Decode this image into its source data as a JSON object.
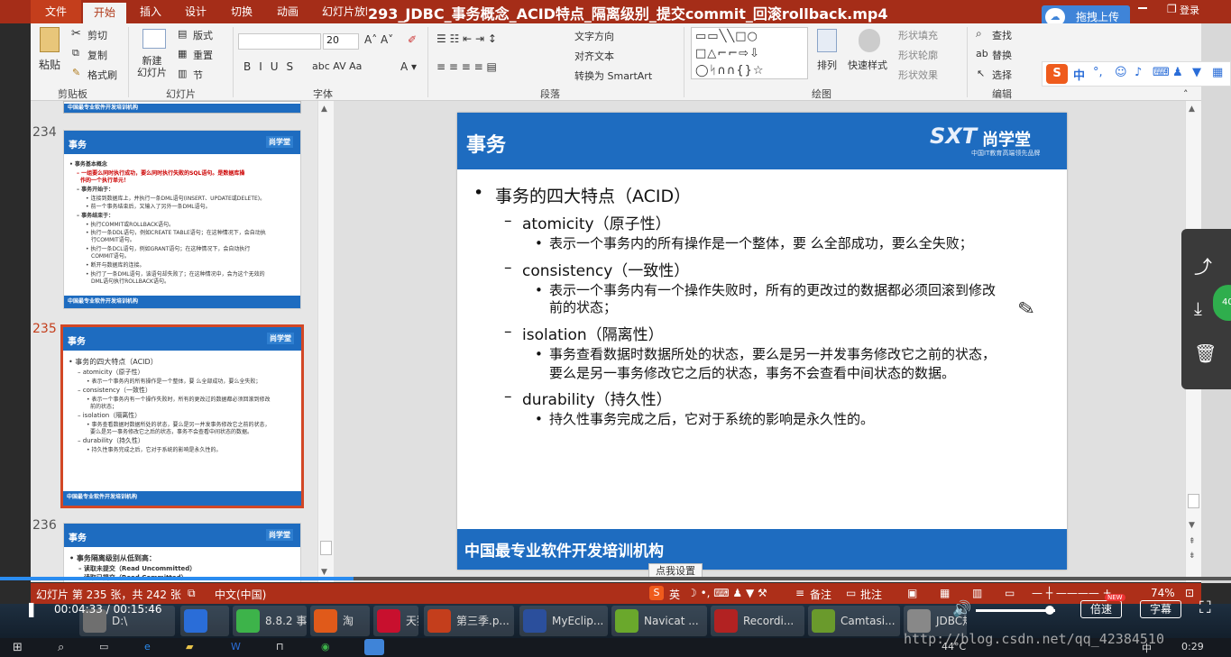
{
  "titlebar": {
    "tabs": [
      "文件",
      "开始",
      "插入",
      "设计",
      "切换",
      "动画",
      "幻灯片放映"
    ],
    "video_title": "293_JDBC_事务概念_ACID特点_隔离级别_提交commit_回滚rollback.mp4",
    "upload_label": "拖拽上传",
    "login_label": "登录"
  },
  "ribbon": {
    "clipboard": {
      "paste": "粘贴",
      "cut": "剪切",
      "copy": "复制",
      "format": "格式刷",
      "group": "剪贴板"
    },
    "slides": {
      "new_slide": "新建\n幻灯片",
      "layout": "版式",
      "reset": "重置",
      "section": "节",
      "group": "幻灯片"
    },
    "font": {
      "size": "20",
      "group": "字体"
    },
    "paragraph": {
      "text_dir": "文字方向",
      "align_text": "对齐文本",
      "smartart": "转换为 SmartArt",
      "group": "段落"
    },
    "drawing": {
      "arrange": "排列",
      "quick_styles": "快速样式",
      "fill": "形状填充",
      "outline": "形状轮廓",
      "effects": "形状效果",
      "group": "绘图"
    },
    "editing": {
      "find": "查找",
      "replace": "替换",
      "select": "选择",
      "group": "编辑"
    }
  },
  "sogou": {
    "lang": "中"
  },
  "thumbnails": [
    {
      "num": "234",
      "title": "事务",
      "logo": "尚学堂",
      "footer": "中国最专业软件开发培训机构",
      "lines": [
        "• 事务基本概念",
        "– 一组要么同时执行成功，要么同时执行失败的SQL语句。是数据库操",
        "作的一个执行单元！",
        "– 事务开始于：",
        "• 连接到数据库上，并执行一条DML语句(INSERT、UPDATE或DELETE)。",
        "• 前一个事务结束后，又输入了另外一条DML语句。",
        "– 事务结束于：",
        "• 执行COMMIT或ROLLBACK语句。",
        "• 执行一条DDL语句，例如CREATE TABLE语句；在这种情况下，会自动执",
        "行COMMIT语句。",
        "• 执行一条DCL语句，例如GRANT语句；在这种情况下，会自动执行",
        "COMMIT语句。",
        "• 断开与数据库的连接。",
        "• 执行了一条DML语句，该语句却失败了；在这种情况中，会为这个无效的",
        "DML语句执行ROLLBACK语句。"
      ]
    },
    {
      "num": "235",
      "title": "事务",
      "logo": "尚学堂",
      "footer": "中国最专业软件开发培训机构",
      "lines": [
        "• 事务的四大特点（ACID）",
        "– atomicity（原子性）",
        "• 表示一个事务内的所有操作是一个整体，要 么全部成功，要么全失败；",
        "– consistency（一致性）",
        "• 表示一个事务内有一个操作失败时，所有的更改过的数据都必须回滚到修改",
        "前的状态；",
        "– isolation（隔离性）",
        "• 事务查看数据时数据所处的状态，要么是另一并发事务修改它之前的状态，",
        "要么是另一事务修改它之后的状态，事务不会查看中间状态的数据。",
        "– durability（持久性）",
        "• 持久性事务完成之后，它对于系统的影响是永久性的。"
      ]
    },
    {
      "num": "236",
      "title": "事务",
      "logo": "尚学堂",
      "lines": [
        "• 事务隔离级别从低到高：",
        "– 读取未提交（Read Uncommitted）",
        "– 读取已提交（Read Committed）"
      ]
    }
  ],
  "slide": {
    "title": "事务",
    "logo_mark": "SXT",
    "logo_name": "尚学堂",
    "logo_sub": "中国IT教育高端领先品牌",
    "footer": "中国最专业软件开发培训机构",
    "heading": "事务的四大特点（ACID）",
    "items": [
      {
        "name": "atomicity（原子性）",
        "desc": [
          "表示一个事务内的所有操作是一个整体，要 么全部成功，要么全失败；"
        ]
      },
      {
        "name": "consistency（一致性）",
        "desc": [
          "表示一个事务内有一个操作失败时，所有的更改过的数据都必须回滚到修改",
          "前的状态；"
        ]
      },
      {
        "name": "isolation（隔离性）",
        "desc": [
          "事务查看数据时数据所处的状态，要么是另一并发事务修改它之前的状态，",
          "要么是另一事务修改它之后的状态，事务不会查看中间状态的数据。"
        ]
      },
      {
        "name": "durability（持久性）",
        "desc": [
          "持久性事务完成之后，它对于系统的影响是永久性的。"
        ]
      }
    ]
  },
  "tooltip": "点我设置",
  "statusbar": {
    "slide_info": "幻灯片 第 235 张，共 242 张",
    "lang": "中文(中国)",
    "ime": "英",
    "notes": "备注",
    "comments": "批注",
    "zoom": "74%"
  },
  "player": {
    "time": "00:04:33 / 00:15:46",
    "progress": 0.287,
    "speed_label": "倍速",
    "new_badge": "NEW",
    "subtitle_label": "字幕",
    "volume": 0.93
  },
  "taskbar": {
    "apps": [
      {
        "label": "D:\\",
        "color": "#6f6f6f"
      },
      {
        "label": "",
        "color": "#2a6dd8"
      },
      {
        "label": "8.8.2 事...",
        "color": "#3db34a"
      },
      {
        "label": "淘",
        "color": "#e05a1a"
      },
      {
        "label": "天猫",
        "color": "#c8102e"
      },
      {
        "label": "第三季.p...",
        "color": "#c43e1c"
      },
      {
        "label": "MyEclip...",
        "color": "#2b4f9c"
      },
      {
        "label": "Navicat ...",
        "color": "#6aa82c"
      },
      {
        "label": "Recordi...",
        "color": "#b22222"
      },
      {
        "label": "Camtasi...",
        "color": "#6a9a2c"
      },
      {
        "label": "JDBC规...",
        "color": "#888888"
      }
    ],
    "temp": "44°C",
    "clock": "0:29",
    "watermark": "http://blog.csdn.net/qq_42384510",
    "tray_lang": "中"
  }
}
